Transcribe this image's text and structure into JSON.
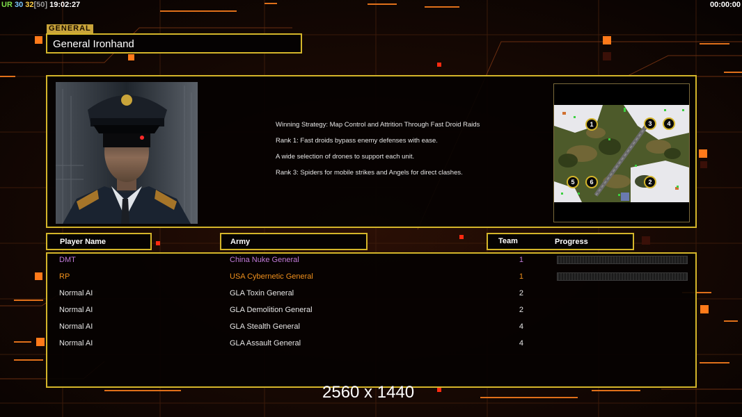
{
  "hud": {
    "ur_label": "UR",
    "n1": "30",
    "n2": "32",
    "cap": "[50]",
    "clock": "19:02:27",
    "timer": "00:00:00"
  },
  "general": {
    "section_label": "GENERAL",
    "name": "General Ironhand"
  },
  "description": {
    "strategy": "Winning Strategy: Map Control and Attrition Through Fast Droid Raids",
    "rank1": "Rank 1: Fast droids bypass enemy defenses with ease.",
    "rank2": "A wide selection of drones to support each unit.",
    "rank3": "Rank 3: Spiders for mobile strikes and Angels for direct clashes."
  },
  "minimap": {
    "start_positions": [
      "1",
      "2",
      "3",
      "4",
      "5",
      "6"
    ]
  },
  "headers": {
    "player_name": "Player Name",
    "army": "Army",
    "team": "Team",
    "progress": "Progress"
  },
  "players": [
    {
      "name": "DMT",
      "army": "China Nuke General",
      "team": "1",
      "color": "#c07ad8",
      "progress": 0
    },
    {
      "name": "RP",
      "army": "USA Cybernetic General",
      "team": "1",
      "color": "#f0901c",
      "progress": 0
    },
    {
      "name": "Normal AI",
      "army": "GLA Toxin General",
      "team": "2",
      "color": "#e6e6e6"
    },
    {
      "name": "Normal AI",
      "army": "GLA Demolition General",
      "team": "2",
      "color": "#e6e6e6"
    },
    {
      "name": "Normal AI",
      "army": "GLA Stealth General",
      "team": "4",
      "color": "#e6e6e6"
    },
    {
      "name": "Normal AI",
      "army": "GLA Assault General",
      "team": "4",
      "color": "#e6e6e6"
    }
  ],
  "resolution": "2560 x 1440",
  "colors": {
    "frame": "#d4b52a",
    "accent_orange": "#ff7a1a",
    "accent_red": "#ff2a10"
  }
}
